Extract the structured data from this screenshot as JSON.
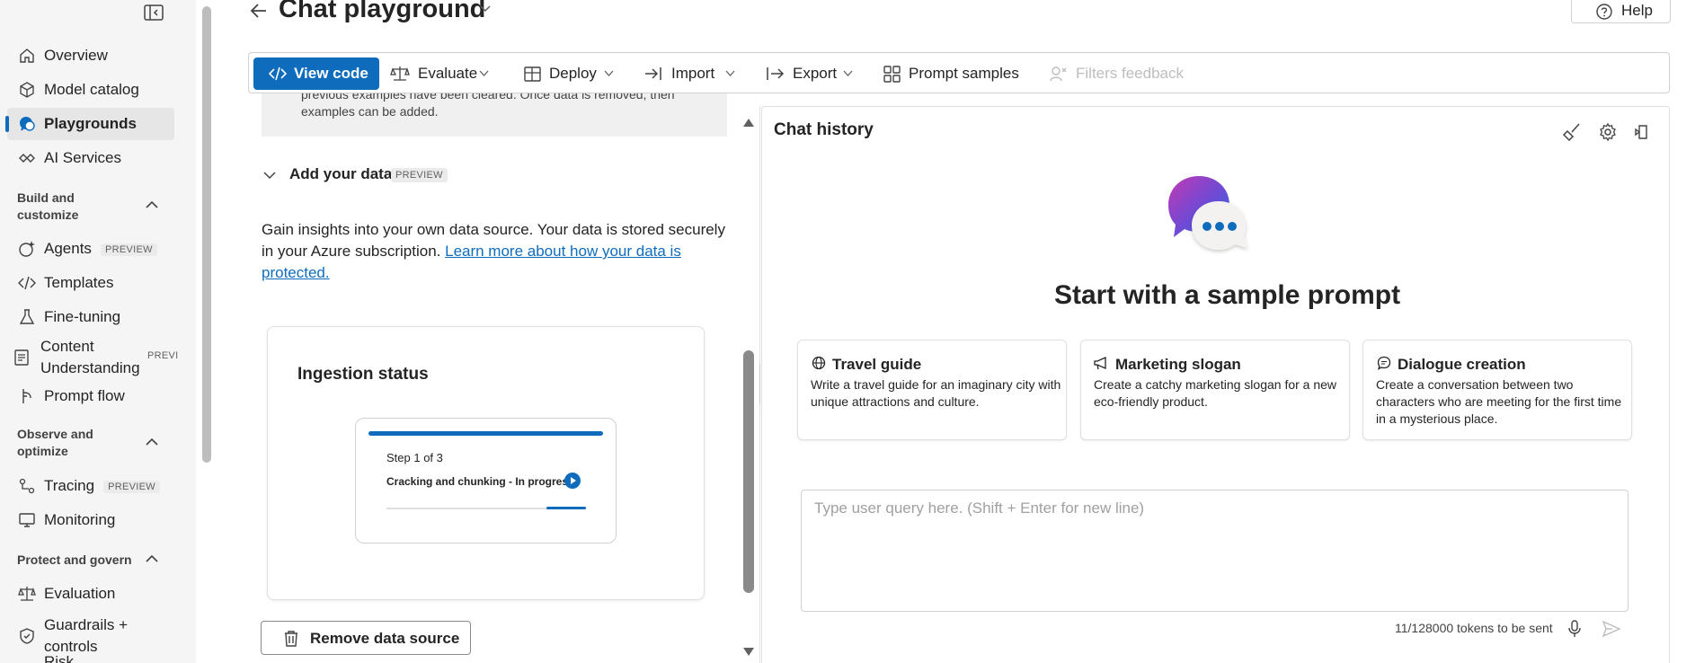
{
  "nav": {
    "items": [
      {
        "label": "Overview",
        "icon": "home-icon"
      },
      {
        "label": "Model catalog",
        "icon": "cube-icon"
      },
      {
        "label": "Playgrounds",
        "icon": "chat-icon",
        "active": true
      },
      {
        "label": "AI Services",
        "icon": "link-icon"
      },
      {
        "label": "Agents",
        "icon": "sparkle-icon",
        "badge": "PREVIEW"
      },
      {
        "label": "Templates",
        "icon": "code-icon"
      },
      {
        "label": "Fine-tuning",
        "icon": "flask-icon"
      },
      {
        "label": "Content Understanding",
        "icon": "document-icon",
        "badge": "PREVI"
      },
      {
        "label": "Prompt flow",
        "icon": "flow-icon"
      },
      {
        "label": "Tracing",
        "icon": "tracing-icon",
        "badge": "PREVIEW"
      },
      {
        "label": "Monitoring",
        "icon": "monitor-icon"
      },
      {
        "label": "Evaluation",
        "icon": "scale-icon"
      },
      {
        "label": "Guardrails + controls",
        "icon": "shield-icon"
      },
      {
        "label": "Risk",
        "icon": "risk-icon"
      }
    ],
    "sections": [
      {
        "label": "Build and customize"
      },
      {
        "label": "Observe and optimize"
      },
      {
        "label": "Protect and govern"
      }
    ]
  },
  "header": {
    "title": "Chat playground",
    "help_label": "Help"
  },
  "toolbar": {
    "view_code": "View code",
    "evaluate": "Evaluate",
    "deploy": "Deploy",
    "import": "Import",
    "export": "Export",
    "prompt_samples": "Prompt samples",
    "filters_feedback": "Filters feedback"
  },
  "left_panel": {
    "notice_line1": "previous examples have been cleared. Once data is removed, then",
    "notice_line2": "examples can be added.",
    "add_data_label": "Add your data",
    "add_data_badge": "PREVIEW",
    "description_text": "Gain insights into your own data source. Your data is stored securely in your Azure subscription. ",
    "description_link": "Learn more about how your data is protected.",
    "ingestion": {
      "title": "Ingestion status",
      "step_label": "Step 1 of 3",
      "step_description": "Cracking and chunking - In progress",
      "progress": 0.2
    },
    "remove_label": "Remove data source"
  },
  "chat": {
    "title": "Chat history",
    "hero_title": "Start with a sample prompt",
    "samples": [
      {
        "title": "Travel guide",
        "icon": "globe-icon",
        "description": "Write a travel guide for an imaginary city with unique attractions and culture."
      },
      {
        "title": "Marketing slogan",
        "icon": "megaphone-icon",
        "description": "Create a catchy marketing slogan for a new eco-friendly product."
      },
      {
        "title": "Dialogue creation",
        "icon": "speech-icon",
        "description": "Create a conversation between two characters who are meeting for the first time in a mysterious place."
      }
    ],
    "query_placeholder": "Type user query here. (Shift + Enter for new line)",
    "tokens_text": "11/128000 tokens to be sent"
  },
  "colors": {
    "accent": "#0f6cbd",
    "nav_bg": "#f5f5f5"
  }
}
